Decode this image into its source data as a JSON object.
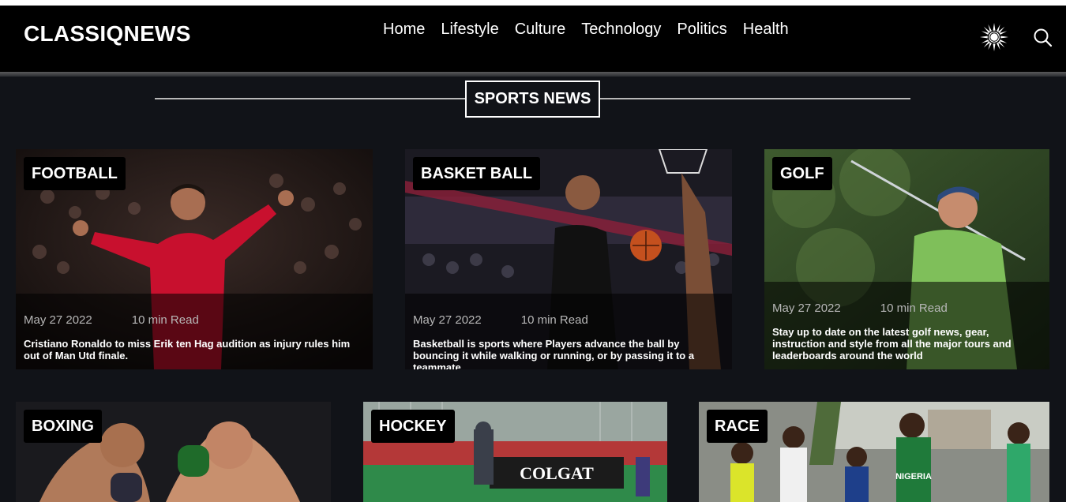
{
  "header": {
    "logo": "CLASSIQNEWS",
    "nav": [
      "Home",
      "Lifestyle",
      "Culture",
      "Technology",
      "Politics",
      "Health"
    ],
    "theme_toggle_icon": "sun-icon",
    "search_icon": "search-icon"
  },
  "section": {
    "title": "SPORTS NEWS"
  },
  "cards": [
    {
      "tag": "FOOTBALL",
      "date": "May 27 2022",
      "read": "10 min Read",
      "desc": "Cristiano Ronaldo to miss Erik ten Hag audition as injury rules him out of Man Utd finale."
    },
    {
      "tag": "BASKET BALL",
      "date": "May 27 2022",
      "read": "10 min Read",
      "desc": "Basketball is sports where Players advance the ball by bouncing it while walking or running, or by passing it to a teammate"
    },
    {
      "tag": "GOLF",
      "date": "May 27 2022",
      "read": "10 min Read",
      "desc": "Stay up to date on the latest golf news, gear, instruction and style from all the major tours and leaderboards around the world"
    },
    {
      "tag": "BOXING"
    },
    {
      "tag": "HOCKEY",
      "banner": "COLGAT"
    },
    {
      "tag": "RACE",
      "bib": "NIGERIA"
    }
  ],
  "colors": {
    "header_bg": "#000000",
    "page_bg": "#111318",
    "accent": "#ffffff"
  }
}
